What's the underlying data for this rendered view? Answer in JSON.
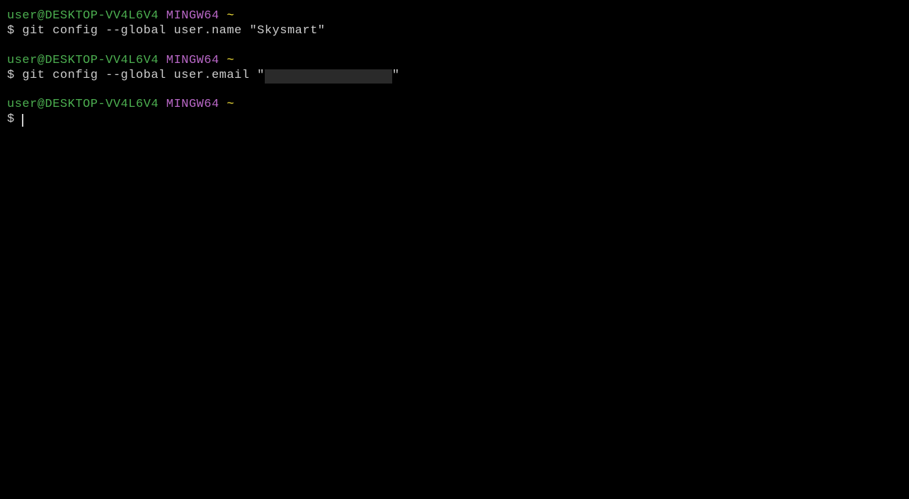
{
  "prompt": {
    "user_host": "user@DESKTOP-VV4L6V4",
    "env": "MINGW64",
    "path": "~",
    "symbol": "$"
  },
  "commands": {
    "cmd1": "git config --global user.name \"Skysmart\"",
    "cmd2_pre": "git config --global user.email \"",
    "cmd2_post": "\""
  }
}
